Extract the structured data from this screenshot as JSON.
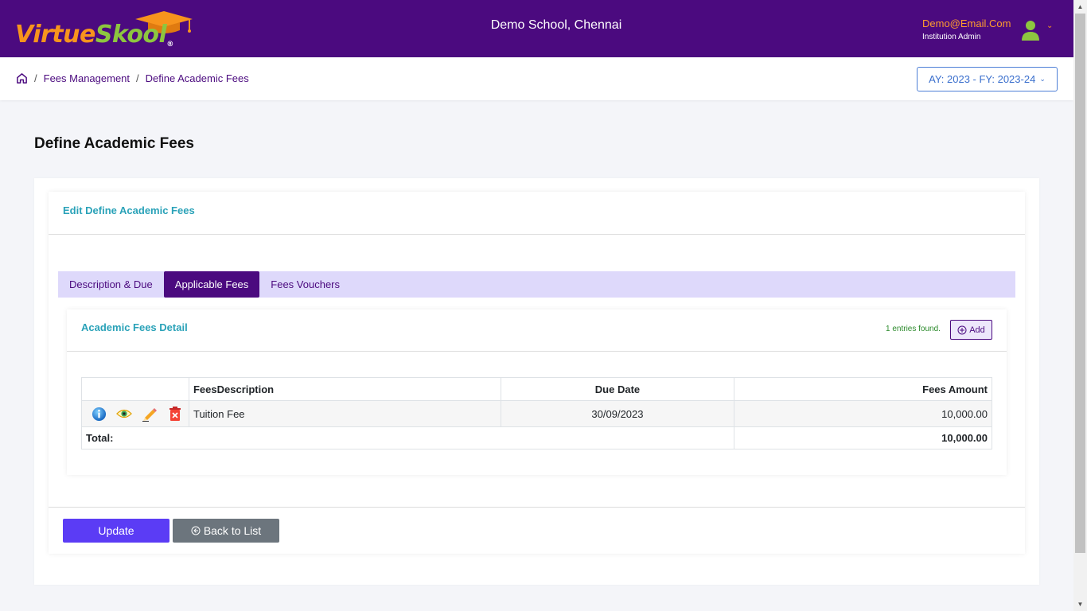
{
  "header": {
    "logo_part1": "Virtue",
    "logo_part2": "Skool",
    "logo_reg": "®",
    "school": "Demo School, Chennai",
    "user_email": "Demo@Email.Com",
    "user_role": "Institution Admin",
    "avatar_icon": "user-icon",
    "colors": {
      "bar": "#4b0a7f",
      "orange": "#f7941d",
      "green": "#8dc63f"
    }
  },
  "breadcrumb": {
    "home_icon": "home-icon",
    "items": [
      "Fees Management",
      "Define Academic Fees"
    ],
    "separator": "/"
  },
  "academic_year": {
    "label": "AY: 2023 - FY: 2023-24"
  },
  "page": {
    "title": "Define Academic Fees",
    "card_title": "Edit Define Academic Fees"
  },
  "tabs": [
    {
      "label": "Description & Due",
      "active": false
    },
    {
      "label": "Applicable Fees",
      "active": true
    },
    {
      "label": "Fees Vouchers",
      "active": false
    }
  ],
  "detail": {
    "title": "Academic Fees Detail",
    "entries": "1 entries found.",
    "add_label": "Add"
  },
  "table": {
    "columns": [
      "",
      "FeesDescription",
      "Due Date",
      "Fees Amount"
    ],
    "rows": [
      {
        "description": "Tuition Fee",
        "due_date": "30/09/2023",
        "amount": "10,000.00",
        "actions": [
          "info-icon",
          "view-icon",
          "edit-icon",
          "delete-icon"
        ]
      }
    ],
    "total_label": "Total:",
    "total_value": "10,000.00"
  },
  "buttons": {
    "update": "Update",
    "back": "Back to List"
  }
}
